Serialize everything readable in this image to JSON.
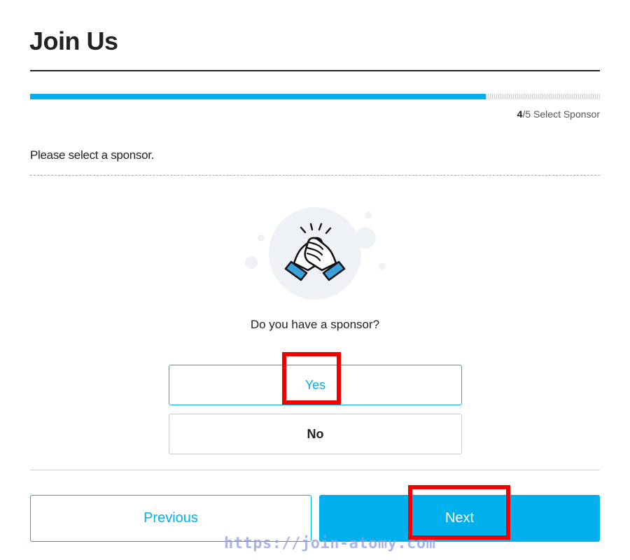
{
  "header": {
    "title": "Join Us"
  },
  "progress": {
    "current": "4",
    "total_suffix": "/5",
    "step_label": " Select Sponsor",
    "fraction": 0.8
  },
  "instruction": {
    "text": "Please select a sponsor."
  },
  "question": {
    "text": "Do you have a sponsor?"
  },
  "options": {
    "yes_label": "Yes",
    "no_label": "No"
  },
  "nav": {
    "previous_label": "Previous",
    "next_label": "Next"
  },
  "watermark": {
    "text": "https://join-atomy.com"
  },
  "colors": {
    "accent": "#00b0ec",
    "highlight": "#f00000",
    "text": "#222222"
  },
  "icons": {
    "illustration": "handshake-icon"
  }
}
